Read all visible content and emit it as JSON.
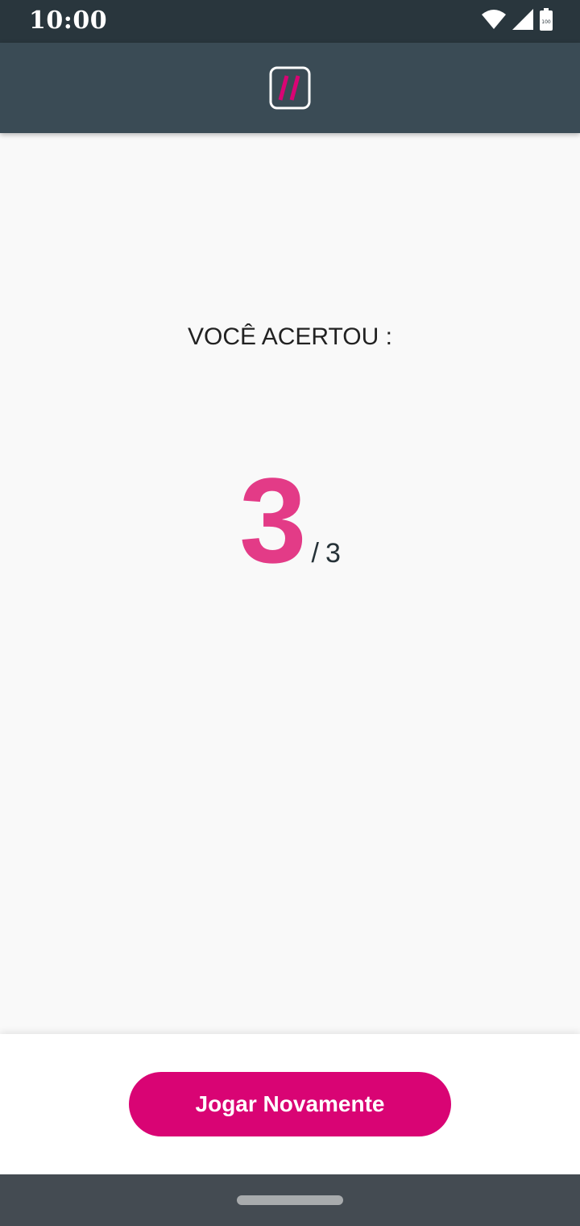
{
  "status_bar": {
    "time": "10:00",
    "icons": [
      "wifi-icon",
      "cell-signal-icon",
      "battery-icon"
    ],
    "battery_level": "100"
  },
  "app_bar": {
    "logo_icon": "double-slash-logo",
    "logo_color": "#d90474"
  },
  "result": {
    "heading": "VOCÊ ACERTOU :",
    "score": "3",
    "separator": "/",
    "total": "3"
  },
  "actions": {
    "play_again_label": "Jogar Novamente"
  },
  "colors": {
    "accent": "#d90474",
    "score": "#e33b87",
    "status_bar": "#29363d",
    "app_bar": "#3a4b55"
  }
}
